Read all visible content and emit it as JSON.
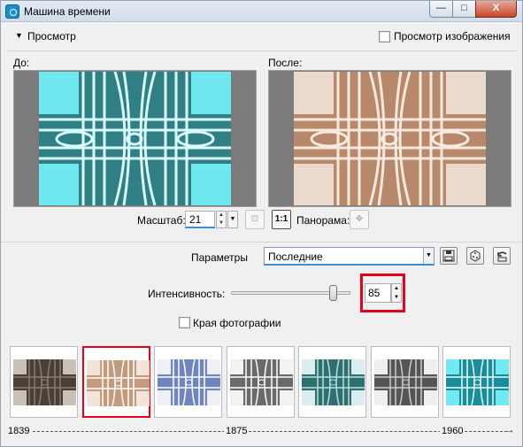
{
  "window": {
    "title": "Машина времени",
    "minimize": "—",
    "maximize": "□",
    "close": "X"
  },
  "preview": {
    "toggle": "▼",
    "title": "Просмотр",
    "show_image_label": "Просмотр изображения",
    "before_label": "До:",
    "after_label": "После:"
  },
  "zoom": {
    "label": "Масштаб:",
    "value": "21",
    "one_to_one": "1:1",
    "pan_label": "Панорама:"
  },
  "params": {
    "label": "Параметры",
    "selected": "Последние"
  },
  "intensity": {
    "label": "Интенсивность:",
    "value": "85",
    "level_percent": 85
  },
  "edges": {
    "label": "Края фотографии"
  },
  "thumbnails": [
    "dark-sepia",
    "sepia",
    "blue",
    "grayscale",
    "teal",
    "gray-dark",
    "cyan"
  ],
  "timeline": {
    "start": "1839",
    "middle": "1875",
    "end": "1960"
  },
  "colors": {
    "highlight": "#e8001c",
    "accent": "#3b8fd9"
  }
}
